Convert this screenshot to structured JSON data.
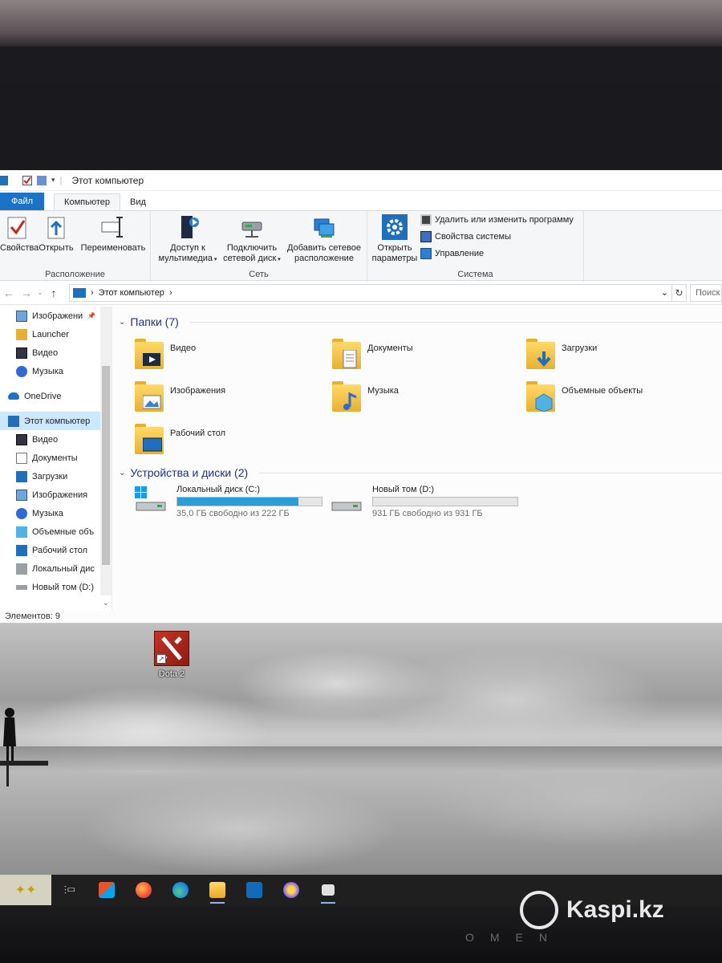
{
  "window": {
    "title": "Этот компьютер",
    "tabs": [
      {
        "label": "Файл"
      },
      {
        "label": "Компьютер"
      },
      {
        "label": "Вид"
      }
    ]
  },
  "ribbon": {
    "location": {
      "label": "Расположение",
      "buttons": [
        "Свойства",
        "Открыть",
        "Переименовать"
      ]
    },
    "network": {
      "label": "Сеть",
      "buttons": [
        {
          "line1": "Доступ к",
          "line2": "мультимедиа"
        },
        {
          "line1": "Подключить",
          "line2": "сетевой диск"
        },
        {
          "line1": "Добавить сетевое",
          "line2": "расположение"
        }
      ]
    },
    "system": {
      "label": "Система",
      "open_params": {
        "line1": "Открыть",
        "line2": "параметры"
      },
      "links": [
        "Удалить или изменить программу",
        "Свойства системы",
        "Управление"
      ]
    }
  },
  "address": {
    "path": "Этот компьютер",
    "search_placeholder": "Поиск"
  },
  "nav": {
    "items": [
      {
        "label": "Изображени",
        "icon": "pictures-icon"
      },
      {
        "label": "Launcher",
        "icon": "folder-icon"
      },
      {
        "label": "Видео",
        "icon": "video-icon"
      },
      {
        "label": "Музыка",
        "icon": "music-icon"
      },
      {
        "label": "OneDrive",
        "icon": "onedrive-icon"
      },
      {
        "label": "Этот компьютер",
        "icon": "computer-icon"
      },
      {
        "label": "Видео",
        "icon": "video-icon"
      },
      {
        "label": "Документы",
        "icon": "documents-icon"
      },
      {
        "label": "Загрузки",
        "icon": "downloads-icon"
      },
      {
        "label": "Изображения",
        "icon": "pictures-icon"
      },
      {
        "label": "Музыка",
        "icon": "music-icon"
      },
      {
        "label": "Объемные объ",
        "icon": "3d-objects-icon"
      },
      {
        "label": "Рабочий стол",
        "icon": "desktop-icon"
      },
      {
        "label": "Локальный дис",
        "icon": "local-disk-icon"
      },
      {
        "label": "Новый том (D:)",
        "icon": "drive-icon"
      }
    ]
  },
  "folders": {
    "header": "Папки (7)",
    "items": [
      "Видео",
      "Документы",
      "Загрузки",
      "Изображения",
      "Музыка",
      "Объемные объекты",
      "Рабочий стол"
    ]
  },
  "drives": {
    "header": "Устройства и диски (2)",
    "items": [
      {
        "name": "Локальный диск (C:)",
        "free": "35,0 ГБ свободно из 222 ГБ",
        "used_fraction": 0.84
      },
      {
        "name": "Новый том (D:)",
        "free": "931 ГБ свободно из 931 ГБ",
        "used_fraction": 0.0
      }
    ]
  },
  "status": {
    "items_count": "Элементов: 9"
  },
  "desktop": {
    "icon_label": "Dota 2"
  },
  "bezel": {
    "brand": "OMEN"
  },
  "watermark": {
    "text": "Kaspi.kz"
  }
}
